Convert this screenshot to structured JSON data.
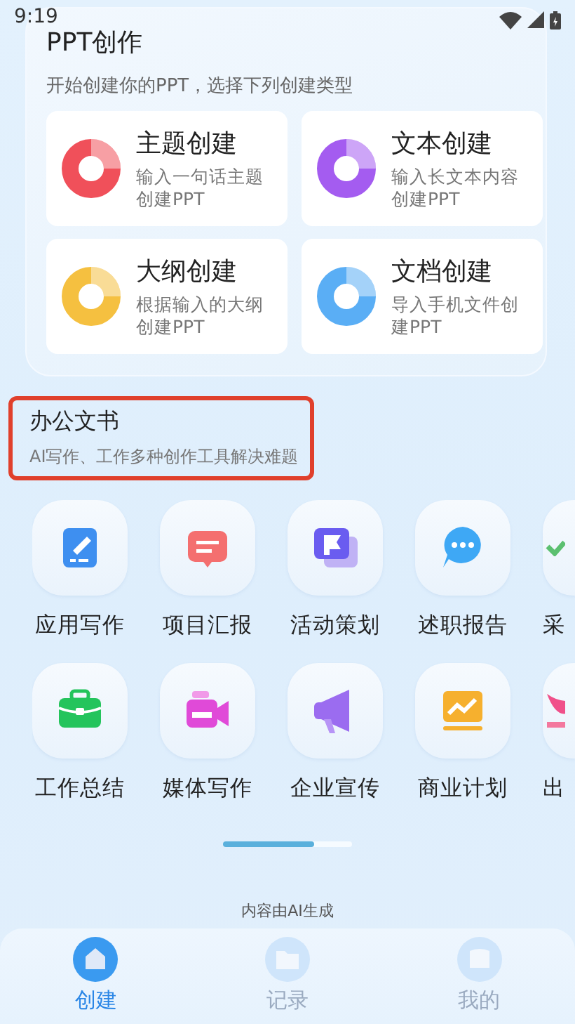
{
  "status_bar": {
    "time": "9:19"
  },
  "ppt_card": {
    "title": "PPT创作",
    "subtitle": "开始创建你的PPT，选择下列创建类型",
    "options": [
      {
        "title": "主题创建",
        "description": "输入一句话主题创建PPT",
        "color": "#f0505a"
      },
      {
        "title": "文本创建",
        "description": "输入长文本内容创建PPT",
        "color": "#a45cf0"
      },
      {
        "title": "大纲创建",
        "description": "根据输入的大纲创建PPT",
        "color": "#f5c040"
      },
      {
        "title": "文档创建",
        "description": "导入手机文件创建PPT",
        "color": "#5aaef5"
      }
    ]
  },
  "office_section": {
    "title": "办公文书",
    "subtitle": "AI写作、工作多种创作工具解决难题",
    "highlighted": true
  },
  "tools": [
    {
      "label": "应用写作"
    },
    {
      "label": "项目汇报"
    },
    {
      "label": "活动策划"
    },
    {
      "label": "述职报告"
    },
    {
      "label": "采"
    },
    {
      "label": "工作总结"
    },
    {
      "label": "媒体写作"
    },
    {
      "label": "企业宣传"
    },
    {
      "label": "商业计划"
    },
    {
      "label": "出"
    }
  ],
  "footer_note": "内容由AI生成",
  "nav": [
    {
      "label": "创建",
      "selected": true
    },
    {
      "label": "记录",
      "selected": false
    },
    {
      "label": "我的",
      "selected": false
    }
  ]
}
